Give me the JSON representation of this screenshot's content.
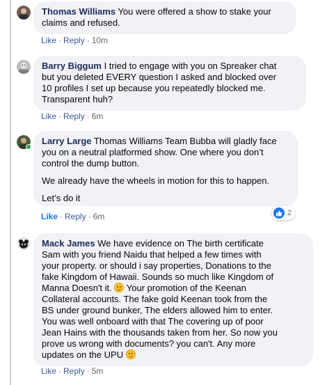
{
  "colors": {
    "bubble": "#f0f2f5",
    "author": "#1c2b5a",
    "action": "#385898",
    "like_blue": "#1877f2",
    "online": "#31a24c"
  },
  "comments": [
    {
      "author": "Thomas Williams",
      "lines": [
        " You were offered a show to stake your",
        "claims and refused."
      ],
      "like": "Like",
      "reply": "Reply",
      "time": "10m",
      "avatar_icon": "avatar-thomas-williams"
    },
    {
      "author": "Barry Biggum",
      "lines": [
        " I tried to engage with you on Spreaker chat",
        "but you deleted EVERY question I asked and blocked over",
        "10 profiles I set up because you repeatedly blocked me.",
        "Transparent huh?"
      ],
      "like": "Like",
      "reply": "Reply",
      "time": "6m",
      "avatar_icon": "avatar-barry-biggum"
    },
    {
      "author": "Larry Large",
      "lines": [
        " Thomas Williams Team Bubba will gladly face",
        "you on a neutral platformed show. One where you don’t",
        "control the dump button."
      ],
      "para2": "We already have the wheels in motion for this to happen.",
      "para3": "Let’s do it",
      "like": "Like",
      "reply": "Reply",
      "time": "6m",
      "reaction_count": "2",
      "avatar_icon": "avatar-larry-large"
    },
    {
      "author": "Mack James",
      "lines": [
        " We have evidence on The birth certificate",
        "Sam with you friend Naidu that helped a few times with",
        "your property. or should i say properties, Donations to the",
        "fake Kingdom of Hawaii. Sounds so much like Kingdom of",
        "Manna Doesn't it. ",
        " Your promotion of the Keenan",
        "Collateral accounts. The fake gold Keenan took from the",
        "BS under ground bunker, The elders allowed him to enter.",
        "You was well onboard with that The covering up of poor",
        "Jean Hains with the thousands taken from her. So now you",
        "prove us wrong with documents? you can't. Any more",
        "updates on the UPU "
      ],
      "like": "Like",
      "reply": "Reply",
      "time": "5m",
      "avatar_icon": "avatar-mack-james"
    }
  ]
}
